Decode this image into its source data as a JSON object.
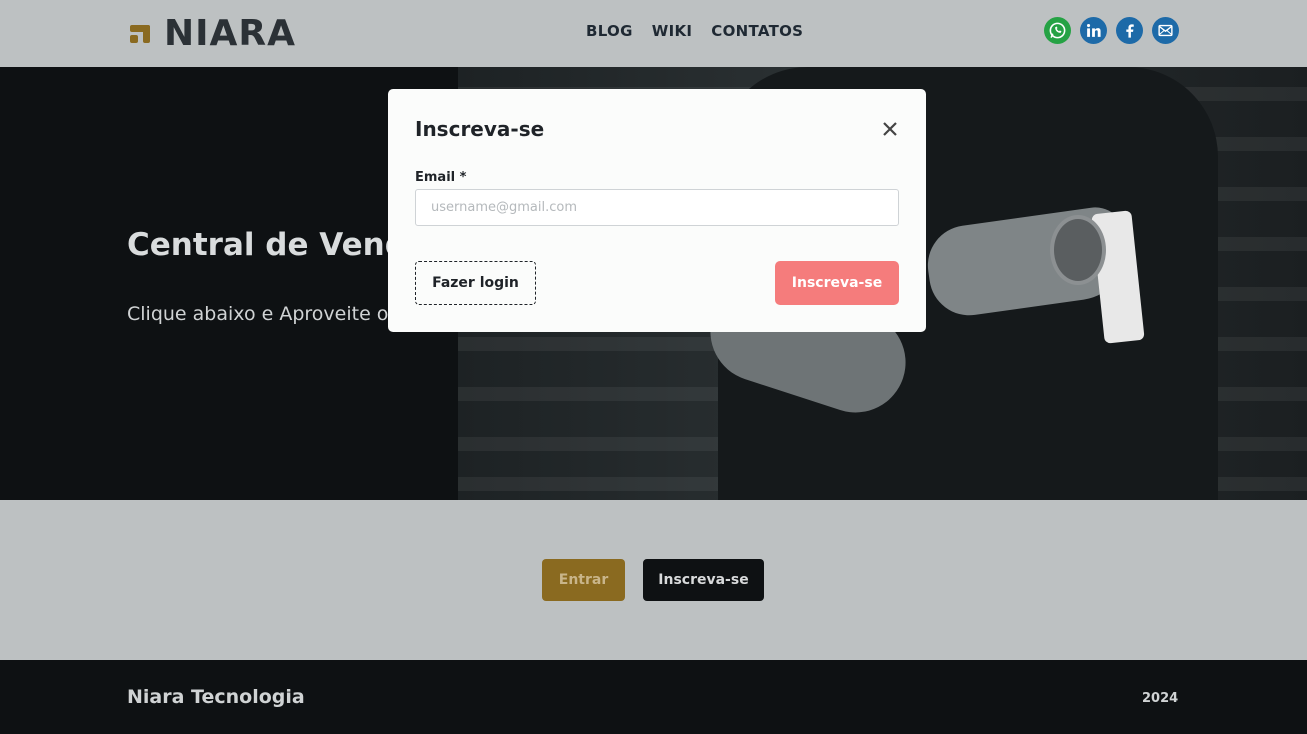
{
  "header": {
    "logo_text": "NIARA",
    "nav": [
      {
        "label": "BLOG"
      },
      {
        "label": "WIKI"
      },
      {
        "label": "CONTATOS"
      }
    ],
    "social": [
      {
        "icon": "whatsapp-icon",
        "color": "#25a244"
      },
      {
        "icon": "linkedin-icon",
        "color": "#1d6aa8"
      },
      {
        "icon": "facebook-icon",
        "color": "#1d6aa8"
      },
      {
        "icon": "email-icon",
        "color": "#1d6aa8"
      }
    ]
  },
  "hero": {
    "title": "Central de Vendas",
    "subtitle": "Clique abaixo e Aproveite o"
  },
  "actions": {
    "entrar_label": "Entrar",
    "inscreva_label": "Inscreva-se"
  },
  "footer": {
    "company": "Niara Tecnologia",
    "year": "2024"
  },
  "modal": {
    "title": "Inscreva-se",
    "close_icon": "close-icon",
    "email_label": "Email *",
    "email_placeholder": "username@gmail.com",
    "email_value": "",
    "login_label": "Fazer login",
    "submit_label": "Inscreva-se"
  },
  "colors": {
    "brand_gold": "#8a6a20",
    "dark": "#0e1113",
    "light_bg": "#bdc1c2",
    "submit_pink": "#f57c7c"
  }
}
